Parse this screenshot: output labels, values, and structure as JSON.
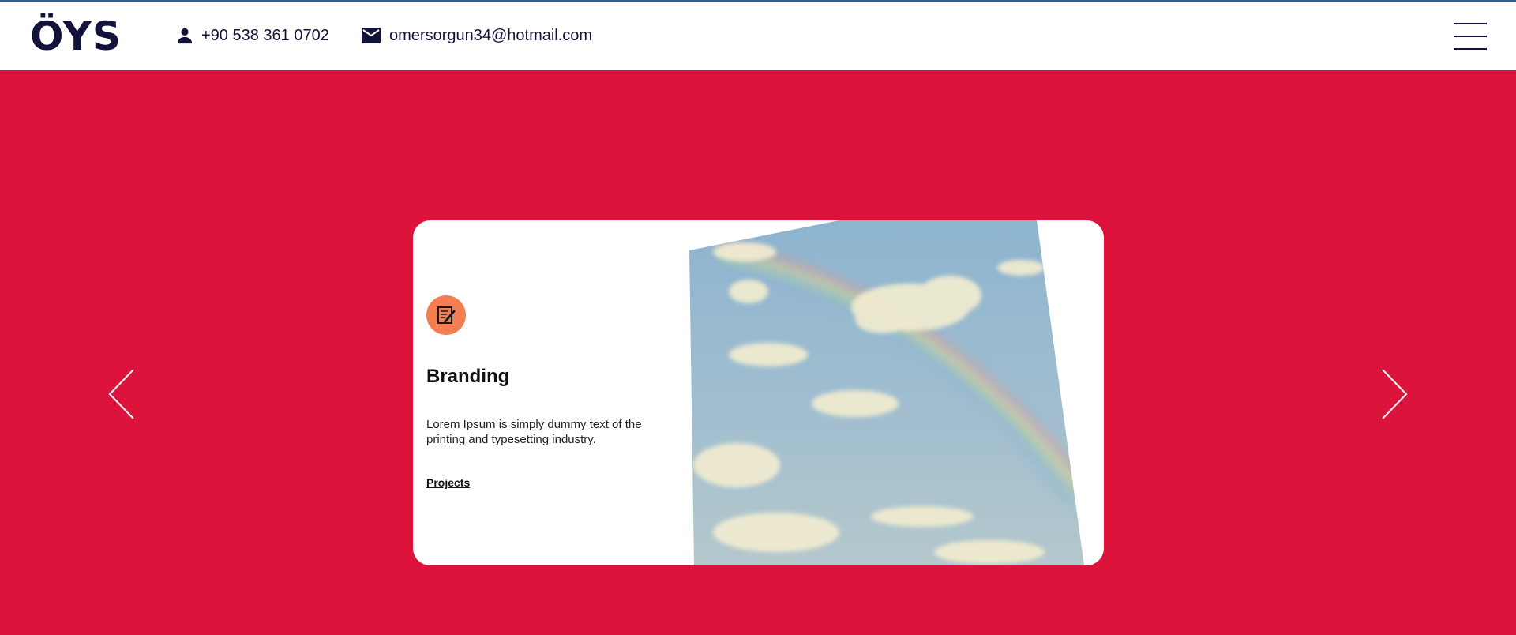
{
  "header": {
    "logo": "ÖYS",
    "phone": "+90 538 361 0702",
    "email": "omersorgun34@hotmail.com",
    "phone_icon": "person-icon",
    "email_icon": "envelope-icon",
    "menu_icon": "hamburger-menu-icon"
  },
  "slider": {
    "prev_icon": "chevron-left-icon",
    "next_icon": "chevron-right-icon",
    "card": {
      "icon": "edit-document-icon",
      "title": "Branding",
      "description": "Lorem Ipsum is simply dummy text of the printing and typesetting industry.",
      "link_label": "Projects"
    }
  },
  "colors": {
    "hero_background": "#dc143c",
    "brand_text": "#12123a",
    "icon_circle": "#f47e52",
    "top_border": "#2b5fa8"
  }
}
